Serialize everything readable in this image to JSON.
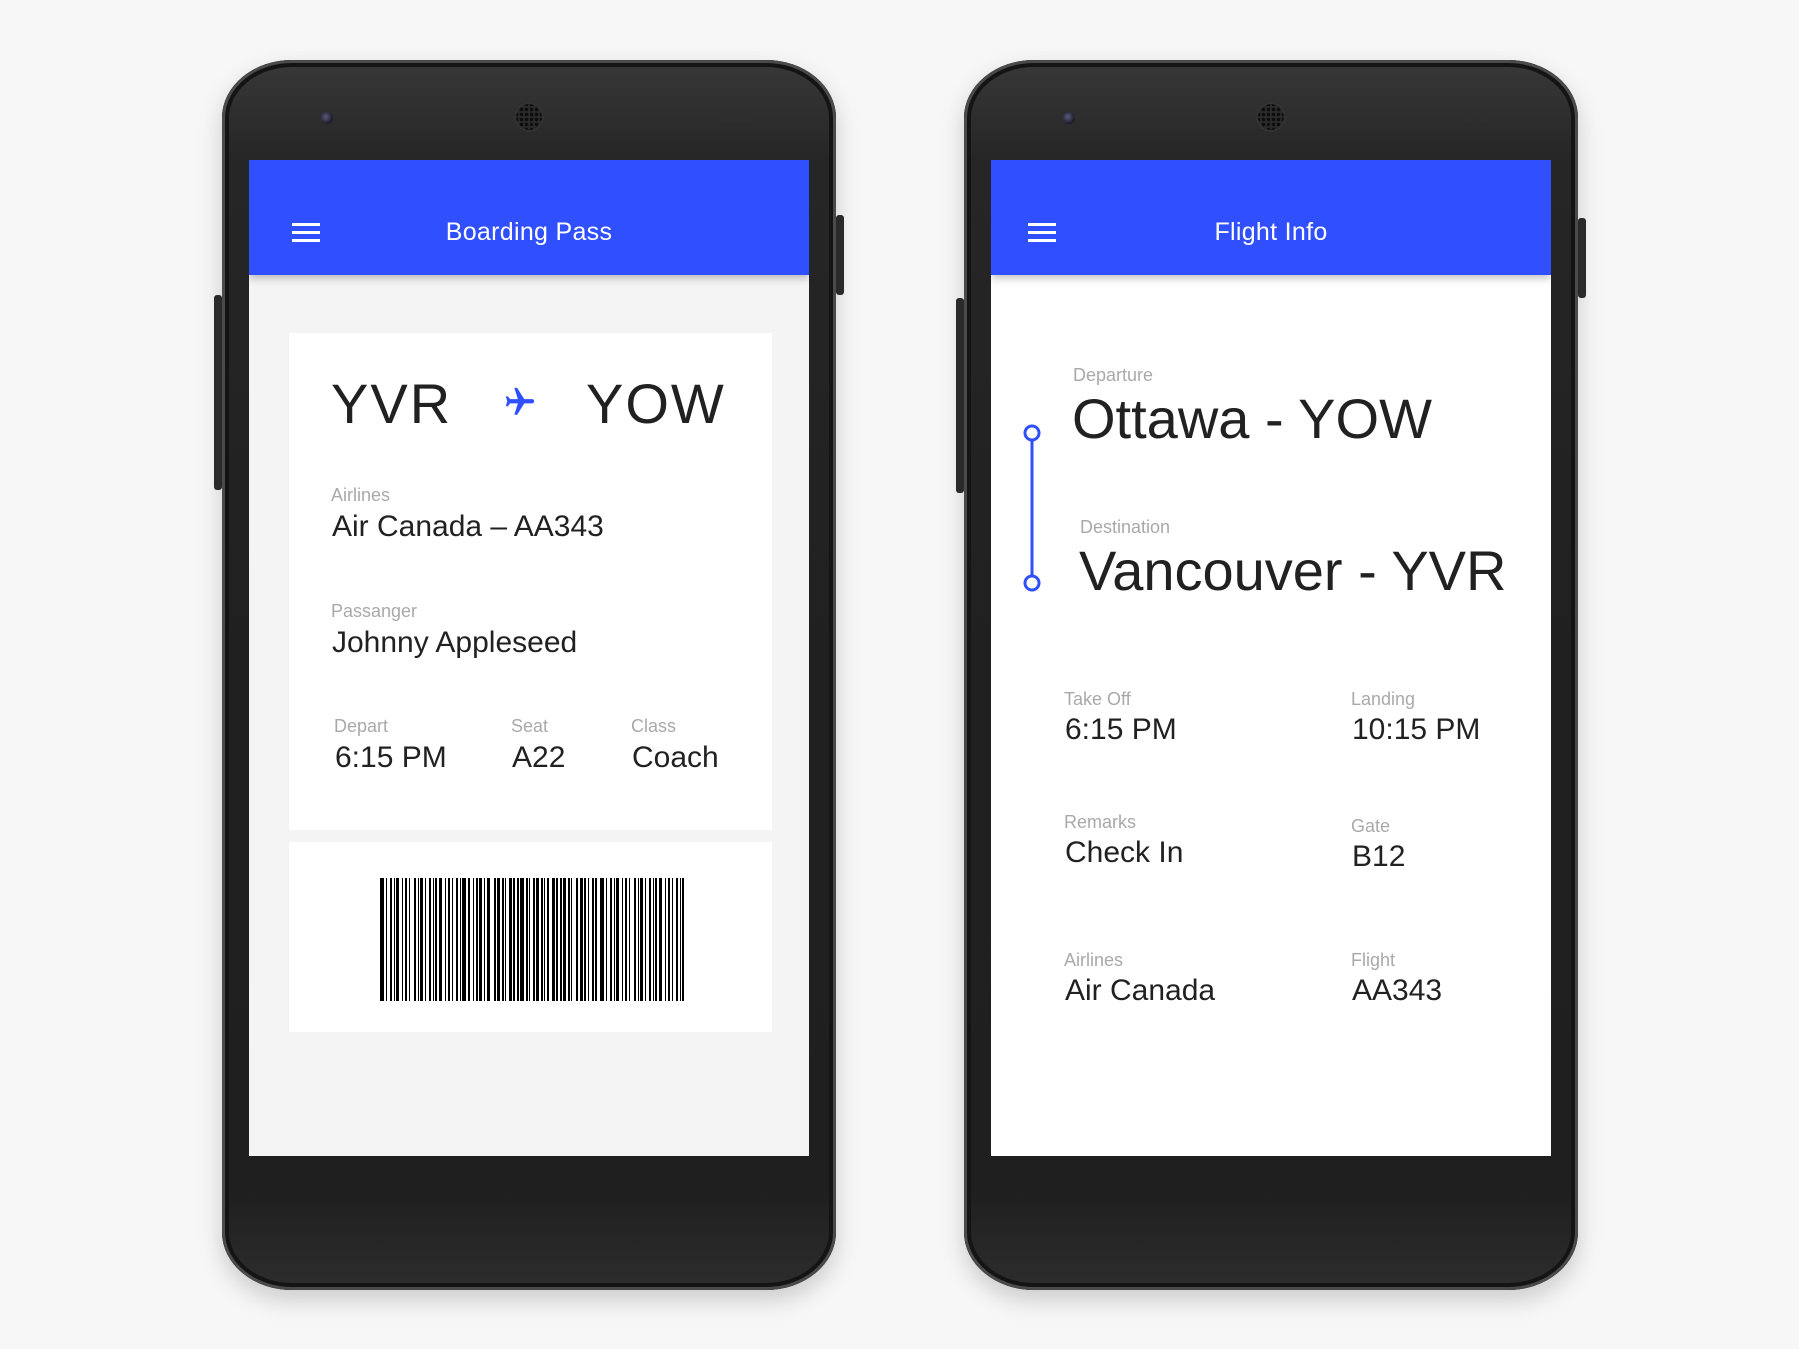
{
  "boarding_pass": {
    "title": "Boarding Pass",
    "from": "YVR",
    "to": "YOW",
    "airlines_label": "Airlines",
    "airlines_value": "Air Canada – AA343",
    "passenger_label": "Passanger",
    "passenger_value": "Johnny Appleseed",
    "depart_label": "Depart",
    "depart_value": "6:15 PM",
    "seat_label": "Seat",
    "seat_value": "A22",
    "class_label": "Class",
    "class_value": "Coach"
  },
  "flight_info": {
    "title": "Flight Info",
    "departure_label": "Departure",
    "departure_value": "Ottawa - YOW",
    "destination_label": "Destination",
    "destination_value": "Vancouver - YVR",
    "takeoff_label": "Take Off",
    "takeoff_value": "6:15 PM",
    "landing_label": "Landing",
    "landing_value": "10:15 PM",
    "remarks_label": "Remarks",
    "remarks_value": "Check In",
    "gate_label": "Gate",
    "gate_value": "B12",
    "airlines_label": "Airlines",
    "airlines_value": "Air Canada",
    "flight_label": "Flight",
    "flight_value": "AA343"
  },
  "icons": {
    "menu": "menu-icon",
    "plane": "airplane-icon",
    "timeline": "route-timeline-icon"
  },
  "colors": {
    "accent": "#304ffe",
    "text": "#212121",
    "label": "#a9a9a9"
  }
}
